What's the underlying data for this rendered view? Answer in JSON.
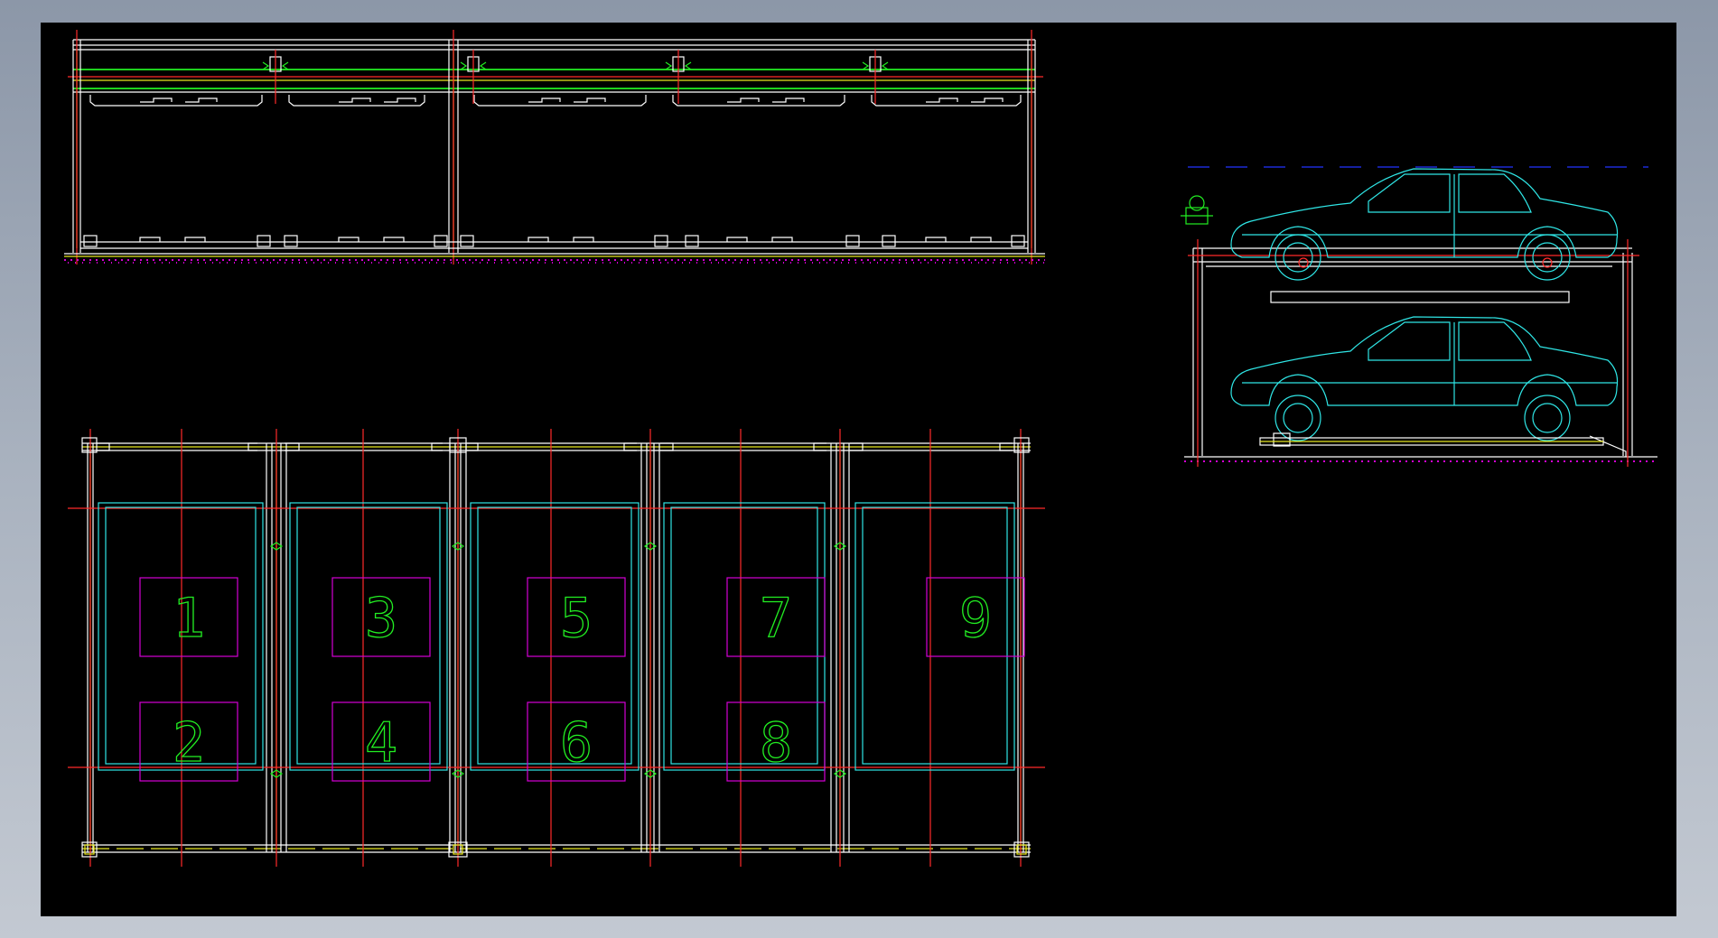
{
  "window": {
    "title": "",
    "background_gradient": [
      "#8c97a8",
      "#c3c9d2"
    ]
  },
  "drawing": {
    "background": "#000000",
    "colors": {
      "frame": "#ffffff",
      "axis": "#ff2a2a",
      "cyan": "#2fe6e6",
      "green": "#22ee22",
      "yellow": "#e8e820",
      "magenta": "#d400d4",
      "number": "#22ee22",
      "blue": "#2233ff"
    },
    "views": {
      "top_elevation": {
        "name": "front-elevation-view"
      },
      "plan": {
        "name": "plan-view"
      },
      "side": {
        "name": "side-elevation-view"
      }
    },
    "parking_spaces": [
      {
        "id": "space-1",
        "number": "1"
      },
      {
        "id": "space-2",
        "number": "2"
      },
      {
        "id": "space-3",
        "number": "3"
      },
      {
        "id": "space-4",
        "number": "4"
      },
      {
        "id": "space-5",
        "number": "5"
      },
      {
        "id": "space-6",
        "number": "6"
      },
      {
        "id": "space-7",
        "number": "7"
      },
      {
        "id": "space-8",
        "number": "8"
      },
      {
        "id": "space-9",
        "number": "9"
      }
    ]
  }
}
